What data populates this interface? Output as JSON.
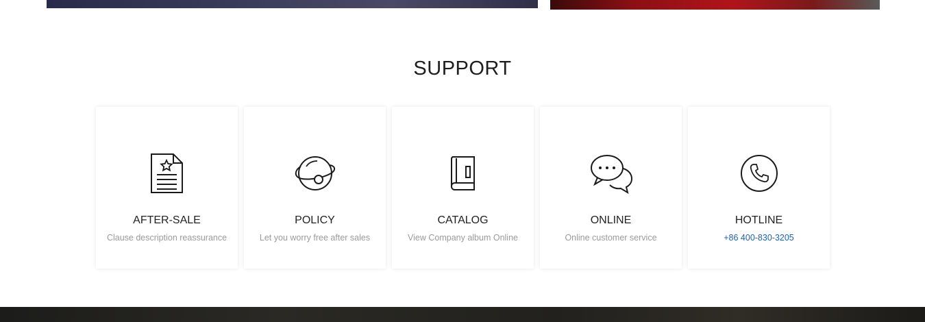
{
  "section": {
    "title": "SUPPORT"
  },
  "cards": [
    {
      "title": "AFTER-SALE",
      "desc": "Clause description reassurance",
      "icon": "document-star-icon"
    },
    {
      "title": "POLICY",
      "desc": "Let you worry free after sales",
      "icon": "planet-icon"
    },
    {
      "title": "CATALOG",
      "desc": "View Company album Online",
      "icon": "book-icon"
    },
    {
      "title": "ONLINE",
      "desc": "Online customer service",
      "icon": "chat-bubbles-icon"
    },
    {
      "title": "HOTLINE",
      "desc": "+86 400-830-3205",
      "icon": "phone-icon"
    }
  ],
  "colors": {
    "title": "#1e1e1e",
    "card_title": "#222222",
    "desc": "#9a9a9a",
    "link": "#1f5fb0"
  }
}
